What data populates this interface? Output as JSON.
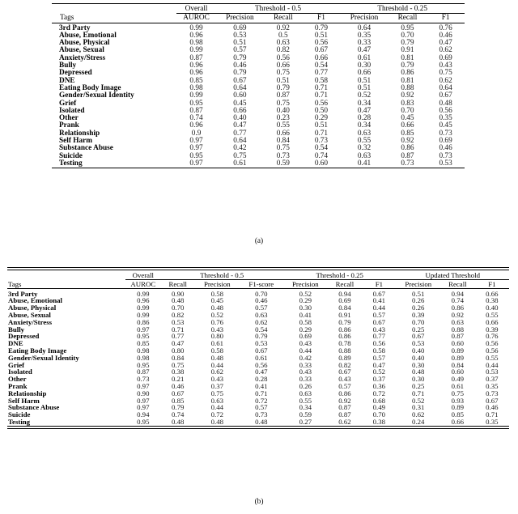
{
  "figure": {
    "caption_a": "(a)",
    "caption_b": "(b)"
  },
  "table_a": {
    "groups": [
      {
        "label": "",
        "span": 1
      },
      {
        "label": "Overall",
        "span": 1
      },
      {
        "label": "Threshold -  0.5",
        "span": 3
      },
      {
        "label": "Threshold -  0.25",
        "span": 3
      }
    ],
    "columns": [
      "Tags",
      "AUROC",
      "Precision",
      "Recall",
      "F1",
      "Precision",
      "Recall",
      "F1"
    ],
    "rows": [
      {
        "tag": "3rd Party",
        "values": [
          "0.99",
          "0.69",
          "0.92",
          "0.79",
          "0.64",
          "0.95",
          "0.76"
        ]
      },
      {
        "tag": "Abuse, Emotional",
        "values": [
          "0.96",
          "0.53",
          "0.5",
          "0.51",
          "0.35",
          "0.70",
          "0.46"
        ]
      },
      {
        "tag": "Abuse, Physical",
        "values": [
          "0.98",
          "0.51",
          "0.63",
          "0.56",
          "0.33",
          "0.79",
          "0.47"
        ]
      },
      {
        "tag": "Abuse, Sexual",
        "values": [
          "0.99",
          "0.57",
          "0.82",
          "0.67",
          "0.47",
          "0.91",
          "0.62"
        ]
      },
      {
        "tag": "Anxiety/Stress",
        "values": [
          "0.87",
          "0.79",
          "0.56",
          "0.66",
          "0.61",
          "0.81",
          "0.69"
        ]
      },
      {
        "tag": "Bully",
        "values": [
          "0.96",
          "0.46",
          "0.66",
          "0.54",
          "0.30",
          "0.79",
          "0.43"
        ]
      },
      {
        "tag": "Depressed",
        "values": [
          "0.96",
          "0.79",
          "0.75",
          "0.77",
          "0.66",
          "0.86",
          "0.75"
        ]
      },
      {
        "tag": "DNE",
        "values": [
          "0.85",
          "0.67",
          "0.51",
          "0.58",
          "0.51",
          "0.81",
          "0.62"
        ]
      },
      {
        "tag": "Eating Body Image",
        "values": [
          "0.98",
          "0.64",
          "0.79",
          "0.71",
          "0.51",
          "0.88",
          "0.64"
        ]
      },
      {
        "tag": "Gender/Sexual Identity",
        "values": [
          "0.99",
          "0.60",
          "0.87",
          "0.71",
          "0.52",
          "0.92",
          "0.67"
        ]
      },
      {
        "tag": "Grief",
        "values": [
          "0.95",
          "0.45",
          "0.75",
          "0.56",
          "0.34",
          "0.83",
          "0.48"
        ]
      },
      {
        "tag": "Isolated",
        "values": [
          "0.87",
          "0.66",
          "0.40",
          "0.50",
          "0.47",
          "0.70",
          "0.56"
        ]
      },
      {
        "tag": "Other",
        "values": [
          "0.74",
          "0.40",
          "0.23",
          "0.29",
          "0.28",
          "0.45",
          "0.35"
        ]
      },
      {
        "tag": "Prank",
        "values": [
          "0.96",
          "0.47",
          "0.55",
          "0.51",
          "0.34",
          "0.66",
          "0.45"
        ]
      },
      {
        "tag": "Relationship",
        "values": [
          "0.9",
          "0.77",
          "0.66",
          "0.71",
          "0.63",
          "0.85",
          "0.73"
        ]
      },
      {
        "tag": "Self Harm",
        "values": [
          "0.97",
          "0.64",
          "0.84",
          "0.73",
          "0.55",
          "0.92",
          "0.69"
        ]
      },
      {
        "tag": "Substance Abuse",
        "values": [
          "0.97",
          "0.42",
          "0.75",
          "0.54",
          "0.32",
          "0.86",
          "0.46"
        ]
      },
      {
        "tag": "Suicide",
        "values": [
          "0.95",
          "0.75",
          "0.73",
          "0.74",
          "0.63",
          "0.87",
          "0.73"
        ]
      },
      {
        "tag": "Testing",
        "values": [
          "0.97",
          "0.61",
          "0.59",
          "0.60",
          "0.41",
          "0.73",
          "0.53"
        ]
      }
    ]
  },
  "table_b": {
    "groups": [
      {
        "label": "",
        "span": 1
      },
      {
        "label": "Overall",
        "span": 1
      },
      {
        "label": "Threshold -  0.5",
        "span": 3
      },
      {
        "label": "Threshold -  0.25",
        "span": 3
      },
      {
        "label": "Updated Threshold",
        "span": 3
      }
    ],
    "columns": [
      "Tags",
      "AUROC",
      "Recall",
      "Precision",
      "F1-score",
      "Precision",
      "Recall",
      "F1",
      "Precision",
      "Recall",
      "F1"
    ],
    "rows": [
      {
        "tag": "3rd Party",
        "values": [
          "0.99",
          "0.90",
          "0.58",
          "0.70",
          "0.52",
          "0.94",
          "0.67",
          "0.51",
          "0.94",
          "0.66"
        ]
      },
      {
        "tag": "Abuse, Emotional",
        "values": [
          "0.96",
          "0.48",
          "0.45",
          "0.46",
          "0.29",
          "0.69",
          "0.41",
          "0.26",
          "0.74",
          "0.38"
        ]
      },
      {
        "tag": "Abuse, Physical",
        "values": [
          "0.99",
          "0.70",
          "0.48",
          "0.57",
          "0.30",
          "0.84",
          "0.44",
          "0.26",
          "0.86",
          "0.40"
        ]
      },
      {
        "tag": "Abuse, Sexual",
        "values": [
          "0.99",
          "0.82",
          "0.52",
          "0.63",
          "0.41",
          "0.91",
          "0.57",
          "0.39",
          "0.92",
          "0.55"
        ]
      },
      {
        "tag": "Anxiety/Stress",
        "values": [
          "0.86",
          "0.53",
          "0.76",
          "0.62",
          "0.58",
          "0.79",
          "0.67",
          "0.70",
          "0.63",
          "0.66"
        ]
      },
      {
        "tag": "Bully",
        "values": [
          "0.97",
          "0.71",
          "0.43",
          "0.54",
          "0.29",
          "0.86",
          "0.43",
          "0.25",
          "0.88",
          "0.39"
        ]
      },
      {
        "tag": "Depressed",
        "values": [
          "0.95",
          "0.77",
          "0.80",
          "0.79",
          "0.69",
          "0.86",
          "0.77",
          "0.67",
          "0.87",
          "0.76"
        ]
      },
      {
        "tag": "DNE",
        "values": [
          "0.85",
          "0.47",
          "0.61",
          "0.53",
          "0.43",
          "0.78",
          "0.56",
          "0.53",
          "0.60",
          "0.56"
        ]
      },
      {
        "tag": "Eating Body Image",
        "values": [
          "0.98",
          "0.80",
          "0.58",
          "0.67",
          "0.44",
          "0.88",
          "0.58",
          "0.40",
          "0.89",
          "0.56"
        ]
      },
      {
        "tag": "Gender/Sexual Identity",
        "values": [
          "0.98",
          "0.84",
          "0.48",
          "0.61",
          "0.42",
          "0.89",
          "0.57",
          "0.40",
          "0.89",
          "0.55"
        ]
      },
      {
        "tag": "Grief",
        "values": [
          "0.95",
          "0.75",
          "0.44",
          "0.56",
          "0.33",
          "0.82",
          "0.47",
          "0.30",
          "0.84",
          "0.44"
        ]
      },
      {
        "tag": "Isolated",
        "values": [
          "0.87",
          "0.38",
          "0.62",
          "0.47",
          "0.43",
          "0.67",
          "0.52",
          "0.48",
          "0.60",
          "0.53"
        ]
      },
      {
        "tag": "Other",
        "values": [
          "0.73",
          "0.21",
          "0.43",
          "0.28",
          "0.33",
          "0.43",
          "0.37",
          "0.30",
          "0.49",
          "0.37"
        ]
      },
      {
        "tag": "Prank",
        "values": [
          "0.97",
          "0.46",
          "0.37",
          "0.41",
          "0.26",
          "0.57",
          "0.36",
          "0.25",
          "0.61",
          "0.35"
        ]
      },
      {
        "tag": "Relationship",
        "values": [
          "0.90",
          "0.67",
          "0.75",
          "0.71",
          "0.63",
          "0.86",
          "0.72",
          "0.71",
          "0.75",
          "0.73"
        ]
      },
      {
        "tag": "Self Harm",
        "values": [
          "0.97",
          "0.85",
          "0.63",
          "0.72",
          "0.55",
          "0.92",
          "0.68",
          "0.52",
          "0.93",
          "0.67"
        ]
      },
      {
        "tag": "Substance Abuse",
        "values": [
          "0.97",
          "0.79",
          "0.44",
          "0.57",
          "0.34",
          "0.87",
          "0.49",
          "0.31",
          "0.89",
          "0.46"
        ]
      },
      {
        "tag": "Suicide",
        "values": [
          "0.94",
          "0.74",
          "0.72",
          "0.73",
          "0.59",
          "0.87",
          "0.70",
          "0.62",
          "0.85",
          "0.71"
        ]
      },
      {
        "tag": "Testing",
        "values": [
          "0.95",
          "0.48",
          "0.48",
          "0.48",
          "0.27",
          "0.62",
          "0.38",
          "0.24",
          "0.66",
          "0.35"
        ]
      }
    ]
  }
}
